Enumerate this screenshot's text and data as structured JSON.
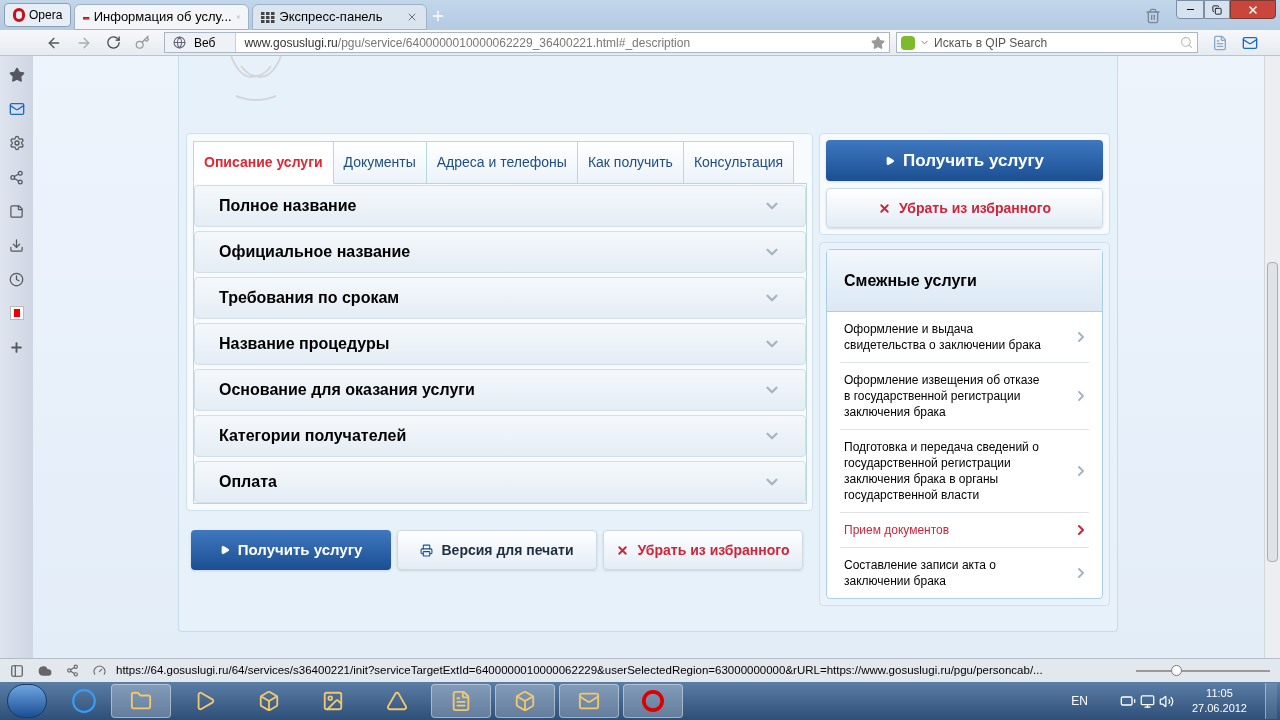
{
  "browser": {
    "menu_label": "Opera",
    "tabs": [
      {
        "label": "Информация об услу...",
        "selected": true,
        "kind": "flag"
      },
      {
        "label": "Экспресс-панель",
        "selected": false,
        "kind": "grid"
      }
    ],
    "address": {
      "prefix": "Веб",
      "host": "www.gosuslugi.ru",
      "path": "/pgu/service/6400000010000062229_36400221.html#_description"
    },
    "search": {
      "placeholder": "Искать в QIP Search"
    }
  },
  "page": {
    "tabs": [
      {
        "label": "Описание услуги",
        "selected": true
      },
      {
        "label": "Документы",
        "selected": false
      },
      {
        "label": "Адреса и телефоны",
        "selected": false
      },
      {
        "label": "Как получить",
        "selected": false
      },
      {
        "label": "Консультация",
        "selected": false
      }
    ],
    "sections": [
      {
        "title": "Полное название",
        "expanded": false
      },
      {
        "title": "Официальное название",
        "expanded": false
      },
      {
        "title": "Требования по срокам",
        "expanded": false
      },
      {
        "title": "Название процедуры",
        "expanded": false
      },
      {
        "title": "Основание для оказания услуги",
        "expanded": false
      },
      {
        "title": "Категории получателей",
        "expanded": false
      },
      {
        "title": "Оплата",
        "expanded": false
      }
    ],
    "bottom_buttons": [
      {
        "label": "Получить услугу",
        "kind": "primary"
      },
      {
        "label": "Версия для печати",
        "kind": "print"
      },
      {
        "label": "Убрать из избранного",
        "kind": "remove"
      }
    ],
    "side_buttons": [
      {
        "label": "Получить услугу",
        "kind": "primary"
      },
      {
        "label": "Убрать из избранного",
        "kind": "remove"
      }
    ],
    "related": {
      "title": "Смежные услуги",
      "items": [
        {
          "label": "Оформление и выдача свидетельства о заключении брака",
          "selected": false
        },
        {
          "label": "Оформление извещения об отказе в государственной регистрации заключения брака",
          "selected": false
        },
        {
          "label": "Подготовка и передача сведений о государственной регистрации заключения брака в органы государственной власти",
          "selected": false
        },
        {
          "label": "Прием документов",
          "selected": true
        },
        {
          "label": "Составление записи акта о заключении брака",
          "selected": false
        }
      ]
    }
  },
  "status_bar": {
    "url": "https://64.gosuslugi.ru/64/services/s36400221/init?serviceTargetExtId=6400000010000062229&userSelectedRegion=63000000000&rURL=https://www.gosuslugi.ru/pgu/personcab/...",
    "zoom": {
      "level": 0.3
    }
  },
  "taskbar": {
    "language": "EN",
    "time": "11:05",
    "date": "27.06.2012"
  }
}
